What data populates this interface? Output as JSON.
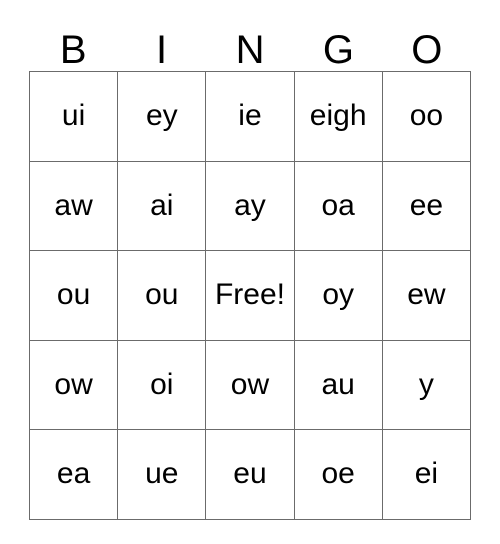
{
  "card": {
    "header_letters": [
      "B",
      "I",
      "N",
      "G",
      "O"
    ],
    "rows": [
      [
        "ui",
        "ey",
        "ie",
        "eigh",
        "oo"
      ],
      [
        "aw",
        "ai",
        "ay",
        "oa",
        "ee"
      ],
      [
        "ou",
        "ou",
        "Free!",
        "oy",
        "ew"
      ],
      [
        "ow",
        "oi",
        "ow",
        "au",
        "y"
      ],
      [
        "ea",
        "ue",
        "eu",
        "oe",
        "ei"
      ]
    ],
    "free_space": {
      "label": "Free!",
      "row_index": 2,
      "column_index": 2
    },
    "colors": {
      "background": "#ffffff",
      "text": "#000000",
      "grid_line": "#6b6b6b",
      "grid_outer_line": "#222222"
    }
  }
}
